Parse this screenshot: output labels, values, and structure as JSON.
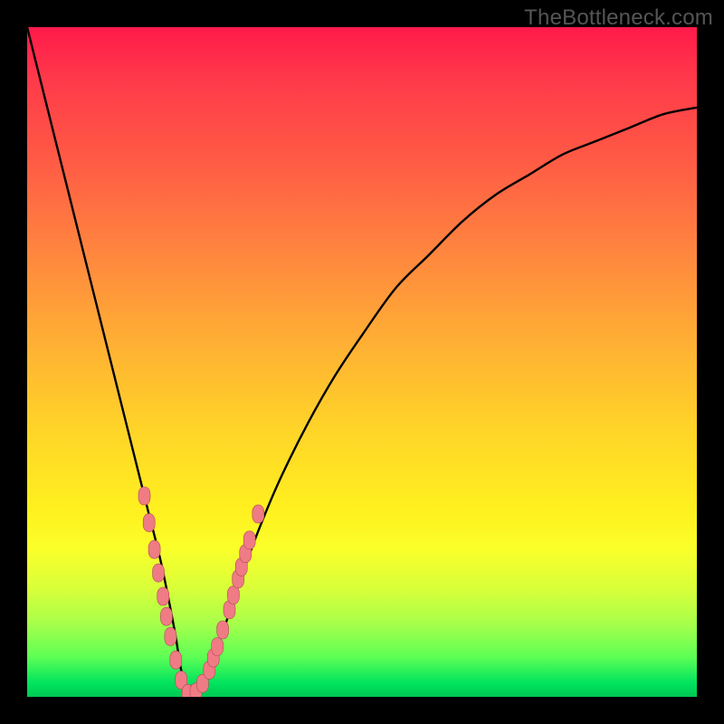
{
  "watermark": "TheBottleneck.com",
  "colors": {
    "frame": "#000000",
    "gradient_top": "#ff1a4a",
    "gradient_mid": "#fff01f",
    "gradient_bottom": "#00c853",
    "curve": "#000000",
    "marker_fill": "#ef7b85",
    "marker_stroke": "#b04a55"
  },
  "chart_data": {
    "type": "line",
    "title": "",
    "xlabel": "",
    "ylabel": "",
    "xlim": [
      0,
      100
    ],
    "ylim": [
      0,
      100
    ],
    "grid": false,
    "legend": null,
    "series": [
      {
        "name": "bottleneck-curve",
        "x": [
          0,
          2,
          4,
          6,
          8,
          10,
          12,
          14,
          16,
          18,
          20,
          22,
          23,
          24,
          25,
          26,
          28,
          30,
          32,
          35,
          38,
          42,
          46,
          50,
          55,
          60,
          65,
          70,
          75,
          80,
          85,
          90,
          95,
          100
        ],
        "y": [
          100,
          92,
          84,
          76,
          68,
          60,
          52,
          44,
          36,
          28,
          20,
          10,
          4,
          1,
          0,
          1,
          6,
          12,
          18,
          26,
          33,
          41,
          48,
          54,
          61,
          66,
          71,
          75,
          78,
          81,
          83,
          85,
          87,
          88
        ]
      }
    ],
    "markers": {
      "name": "highlighted-points",
      "shape": "rounded-rect",
      "color": "#ef7b85",
      "points_xy": [
        [
          17.5,
          30
        ],
        [
          18.2,
          26
        ],
        [
          19.0,
          22
        ],
        [
          19.6,
          18.5
        ],
        [
          20.3,
          15
        ],
        [
          20.8,
          12
        ],
        [
          21.4,
          9
        ],
        [
          22.2,
          5.5
        ],
        [
          23.0,
          2.5
        ],
        [
          24.0,
          0.5
        ],
        [
          25.2,
          0.7
        ],
        [
          26.2,
          2.0
        ],
        [
          27.2,
          4.0
        ],
        [
          27.8,
          5.8
        ],
        [
          28.4,
          7.5
        ],
        [
          29.2,
          10.0
        ],
        [
          30.2,
          13.0
        ],
        [
          30.8,
          15.2
        ],
        [
          31.5,
          17.6
        ],
        [
          32.0,
          19.4
        ],
        [
          32.6,
          21.4
        ],
        [
          33.2,
          23.4
        ],
        [
          34.5,
          27.3
        ]
      ]
    }
  }
}
